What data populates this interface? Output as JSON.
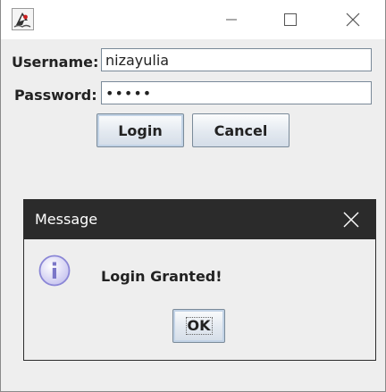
{
  "window": {
    "app_icon": "java-duke-icon",
    "controls": [
      "minimize-icon",
      "maximize-icon",
      "close-icon"
    ]
  },
  "form": {
    "username_label": "Username:",
    "username_value": "nizayulia",
    "password_label": "Password:",
    "password_value": "•••••",
    "login_label": "Login",
    "cancel_label": "Cancel"
  },
  "dialog": {
    "title": "Message",
    "icon": "information-icon",
    "message": "Login Granted!",
    "ok_label": "OK"
  },
  "colors": {
    "dialog_titlebar": "#2b2b2b",
    "window_bg": "#eeeeee",
    "info_icon": "#8a86d6"
  }
}
